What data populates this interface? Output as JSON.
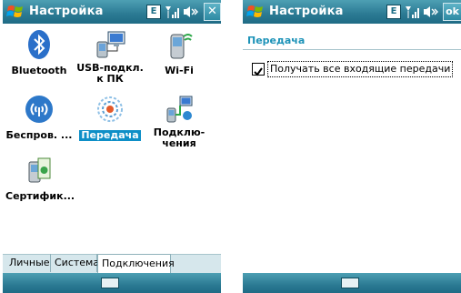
{
  "left": {
    "title": "Настройка",
    "e_label": "E",
    "close_label": "✕",
    "items": [
      {
        "label": "Bluetooth"
      },
      {
        "label": "USB-подкл.\nк ПК"
      },
      {
        "label": "Wi-Fi"
      },
      {
        "label": "Беспров. ..."
      },
      {
        "label": "Передача"
      },
      {
        "label": "Подклю-\nчения"
      },
      {
        "label": "Сертифик..."
      }
    ],
    "tabs": [
      "Личные",
      "Система",
      "Подключения"
    ]
  },
  "right": {
    "title": "Настройка",
    "e_label": "E",
    "ok_label": "ok",
    "section": "Передача",
    "checkbox_label": "Получать все входящие передачи",
    "checkbox_checked": true
  }
}
